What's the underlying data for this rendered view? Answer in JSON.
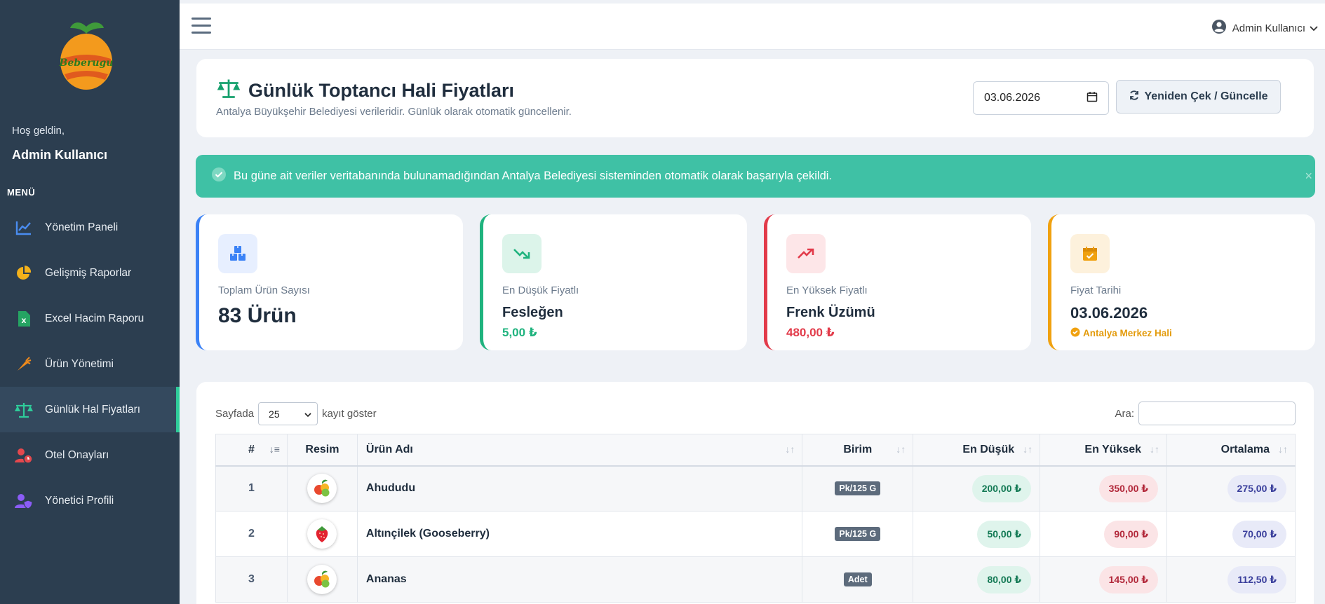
{
  "sidebar": {
    "logo_text": "Beberugu",
    "welcome": "Hoş geldin,",
    "username": "Admin Kullanıcı",
    "menu_title": "MENÜ",
    "items": [
      {
        "label": "Yönetim Paneli",
        "icon": "chart-line-icon",
        "active": false
      },
      {
        "label": "Gelişmiş Raporlar",
        "icon": "pie-chart-icon",
        "active": false
      },
      {
        "label": "Excel Hacim Raporu",
        "icon": "excel-file-icon",
        "active": false
      },
      {
        "label": "Ürün Yönetimi",
        "icon": "carrot-icon",
        "active": false
      },
      {
        "label": "Günlük Hal Fiyatları",
        "icon": "scale-icon",
        "active": true
      },
      {
        "label": "Otel Onayları",
        "icon": "user-clock-icon",
        "active": false
      },
      {
        "label": "Yönetici Profili",
        "icon": "user-shield-icon",
        "active": false
      }
    ]
  },
  "topbar": {
    "user_label": "Admin Kullanıcı"
  },
  "header": {
    "title": "Günlük Toptancı Hali Fiyatları",
    "subtitle": "Antalya Büyükşehir Belediyesi verileridir. Günlük olarak otomatik güncellenir.",
    "date_value": "03.06.2026",
    "refresh_label": "Yeniden Çek / Güncelle"
  },
  "alert": {
    "text": "Bu güne ait veriler veritabanında bulunamadığından Antalya Belediyesi sisteminden otomatik olarak başarıyla çekildi.",
    "close": "×"
  },
  "stats": {
    "total": {
      "label": "Toplam Ürün Sayısı",
      "value": "83 Ürün"
    },
    "lowest": {
      "label": "En Düşük Fiyatlı",
      "name": "Fesleğen",
      "price": "5,00 ₺"
    },
    "highest": {
      "label": "En Yüksek Fiyatlı",
      "name": "Frenk Üzümü",
      "price": "480,00 ₺"
    },
    "date": {
      "label": "Fiyat Tarihi",
      "value": "03.06.2026",
      "place": "Antalya Merkez Hali"
    }
  },
  "table": {
    "length_prefix": "Sayfada",
    "length_value": "25",
    "length_suffix": "kayıt göster",
    "search_label": "Ara:",
    "columns": [
      "#",
      "Resim",
      "Ürün Adı",
      "Birim",
      "En Düşük",
      "En Yüksek",
      "Ortalama"
    ],
    "rows": [
      {
        "num": "1",
        "name": "Ahududu",
        "unit": "Pk/125 G",
        "low": "200,00 ₺",
        "high": "350,00 ₺",
        "avg": "275,00 ₺",
        "img": "fruit-basket-icon"
      },
      {
        "num": "2",
        "name": "Altınçilek (Gooseberry)",
        "unit": "Pk/125 G",
        "low": "50,00 ₺",
        "high": "90,00 ₺",
        "avg": "70,00 ₺",
        "img": "strawberry-icon"
      },
      {
        "num": "3",
        "name": "Ananas",
        "unit": "Adet",
        "low": "80,00 ₺",
        "high": "145,00 ₺",
        "avg": "112,50 ₺",
        "img": "fruit-basket-icon"
      }
    ]
  },
  "colors": {
    "sidebar_bg": "#2c3e50",
    "accent_green": "#3fc1a5",
    "blue": "#3b82f6",
    "green": "#1fb37e",
    "red": "#e23b4a",
    "orange": "#f0a10f"
  }
}
